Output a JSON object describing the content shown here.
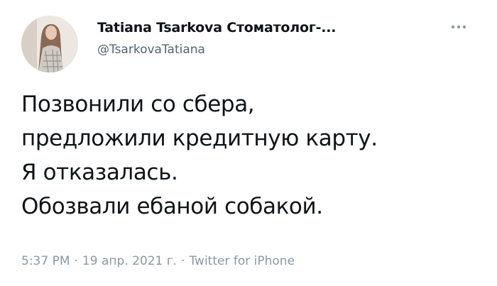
{
  "author": {
    "display_name": "Tatiana Tsarkova Стоматолог-...",
    "handle": "@TsarkovaTatiana"
  },
  "menu": {
    "icon": "more-horizontal-icon"
  },
  "tweet": {
    "lines": [
      "Позвонили со сбера,",
      "предложили кредитную карту.",
      "Я отказалась.",
      "Обозвали ебаной собакой."
    ]
  },
  "meta": {
    "time": "5:37 PM",
    "separator": "·",
    "date": "19 апр. 2021 г.",
    "source": "Twitter for iPhone"
  },
  "colors": {
    "text": "#0f1419",
    "secondary": "#536471",
    "meta": "#8b98a5"
  }
}
